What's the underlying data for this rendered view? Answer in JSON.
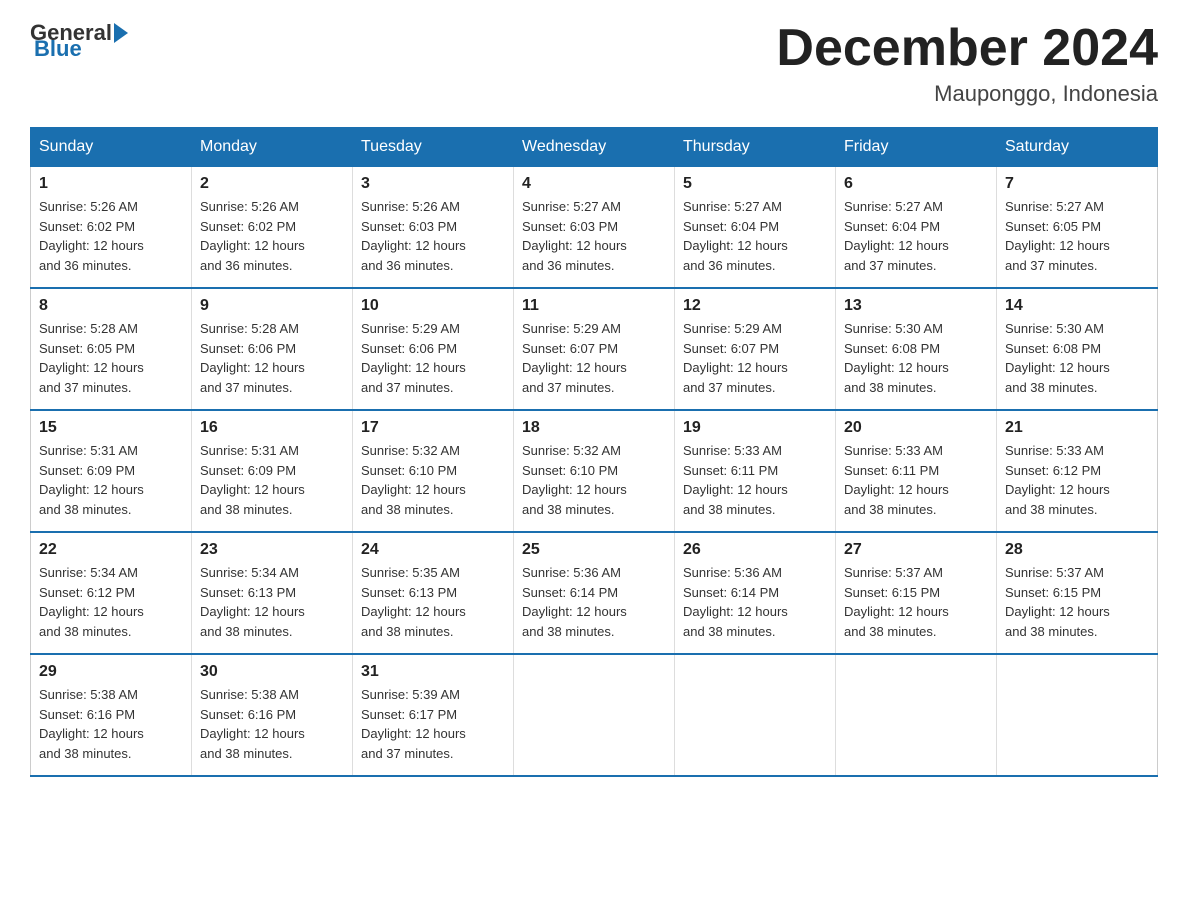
{
  "header": {
    "logo_general": "General",
    "logo_blue": "Blue",
    "month_title": "December 2024",
    "location": "Mauponggo, Indonesia"
  },
  "days_of_week": [
    "Sunday",
    "Monday",
    "Tuesday",
    "Wednesday",
    "Thursday",
    "Friday",
    "Saturday"
  ],
  "weeks": [
    [
      {
        "day": "1",
        "sunrise": "5:26 AM",
        "sunset": "6:02 PM",
        "daylight": "12 hours and 36 minutes."
      },
      {
        "day": "2",
        "sunrise": "5:26 AM",
        "sunset": "6:02 PM",
        "daylight": "12 hours and 36 minutes."
      },
      {
        "day": "3",
        "sunrise": "5:26 AM",
        "sunset": "6:03 PM",
        "daylight": "12 hours and 36 minutes."
      },
      {
        "day": "4",
        "sunrise": "5:27 AM",
        "sunset": "6:03 PM",
        "daylight": "12 hours and 36 minutes."
      },
      {
        "day": "5",
        "sunrise": "5:27 AM",
        "sunset": "6:04 PM",
        "daylight": "12 hours and 36 minutes."
      },
      {
        "day": "6",
        "sunrise": "5:27 AM",
        "sunset": "6:04 PM",
        "daylight": "12 hours and 37 minutes."
      },
      {
        "day": "7",
        "sunrise": "5:27 AM",
        "sunset": "6:05 PM",
        "daylight": "12 hours and 37 minutes."
      }
    ],
    [
      {
        "day": "8",
        "sunrise": "5:28 AM",
        "sunset": "6:05 PM",
        "daylight": "12 hours and 37 minutes."
      },
      {
        "day": "9",
        "sunrise": "5:28 AM",
        "sunset": "6:06 PM",
        "daylight": "12 hours and 37 minutes."
      },
      {
        "day": "10",
        "sunrise": "5:29 AM",
        "sunset": "6:06 PM",
        "daylight": "12 hours and 37 minutes."
      },
      {
        "day": "11",
        "sunrise": "5:29 AM",
        "sunset": "6:07 PM",
        "daylight": "12 hours and 37 minutes."
      },
      {
        "day": "12",
        "sunrise": "5:29 AM",
        "sunset": "6:07 PM",
        "daylight": "12 hours and 37 minutes."
      },
      {
        "day": "13",
        "sunrise": "5:30 AM",
        "sunset": "6:08 PM",
        "daylight": "12 hours and 38 minutes."
      },
      {
        "day": "14",
        "sunrise": "5:30 AM",
        "sunset": "6:08 PM",
        "daylight": "12 hours and 38 minutes."
      }
    ],
    [
      {
        "day": "15",
        "sunrise": "5:31 AM",
        "sunset": "6:09 PM",
        "daylight": "12 hours and 38 minutes."
      },
      {
        "day": "16",
        "sunrise": "5:31 AM",
        "sunset": "6:09 PM",
        "daylight": "12 hours and 38 minutes."
      },
      {
        "day": "17",
        "sunrise": "5:32 AM",
        "sunset": "6:10 PM",
        "daylight": "12 hours and 38 minutes."
      },
      {
        "day": "18",
        "sunrise": "5:32 AM",
        "sunset": "6:10 PM",
        "daylight": "12 hours and 38 minutes."
      },
      {
        "day": "19",
        "sunrise": "5:33 AM",
        "sunset": "6:11 PM",
        "daylight": "12 hours and 38 minutes."
      },
      {
        "day": "20",
        "sunrise": "5:33 AM",
        "sunset": "6:11 PM",
        "daylight": "12 hours and 38 minutes."
      },
      {
        "day": "21",
        "sunrise": "5:33 AM",
        "sunset": "6:12 PM",
        "daylight": "12 hours and 38 minutes."
      }
    ],
    [
      {
        "day": "22",
        "sunrise": "5:34 AM",
        "sunset": "6:12 PM",
        "daylight": "12 hours and 38 minutes."
      },
      {
        "day": "23",
        "sunrise": "5:34 AM",
        "sunset": "6:13 PM",
        "daylight": "12 hours and 38 minutes."
      },
      {
        "day": "24",
        "sunrise": "5:35 AM",
        "sunset": "6:13 PM",
        "daylight": "12 hours and 38 minutes."
      },
      {
        "day": "25",
        "sunrise": "5:36 AM",
        "sunset": "6:14 PM",
        "daylight": "12 hours and 38 minutes."
      },
      {
        "day": "26",
        "sunrise": "5:36 AM",
        "sunset": "6:14 PM",
        "daylight": "12 hours and 38 minutes."
      },
      {
        "day": "27",
        "sunrise": "5:37 AM",
        "sunset": "6:15 PM",
        "daylight": "12 hours and 38 minutes."
      },
      {
        "day": "28",
        "sunrise": "5:37 AM",
        "sunset": "6:15 PM",
        "daylight": "12 hours and 38 minutes."
      }
    ],
    [
      {
        "day": "29",
        "sunrise": "5:38 AM",
        "sunset": "6:16 PM",
        "daylight": "12 hours and 38 minutes."
      },
      {
        "day": "30",
        "sunrise": "5:38 AM",
        "sunset": "6:16 PM",
        "daylight": "12 hours and 38 minutes."
      },
      {
        "day": "31",
        "sunrise": "5:39 AM",
        "sunset": "6:17 PM",
        "daylight": "12 hours and 37 minutes."
      },
      null,
      null,
      null,
      null
    ]
  ],
  "labels": {
    "sunrise": "Sunrise:",
    "sunset": "Sunset:",
    "daylight": "Daylight:"
  }
}
